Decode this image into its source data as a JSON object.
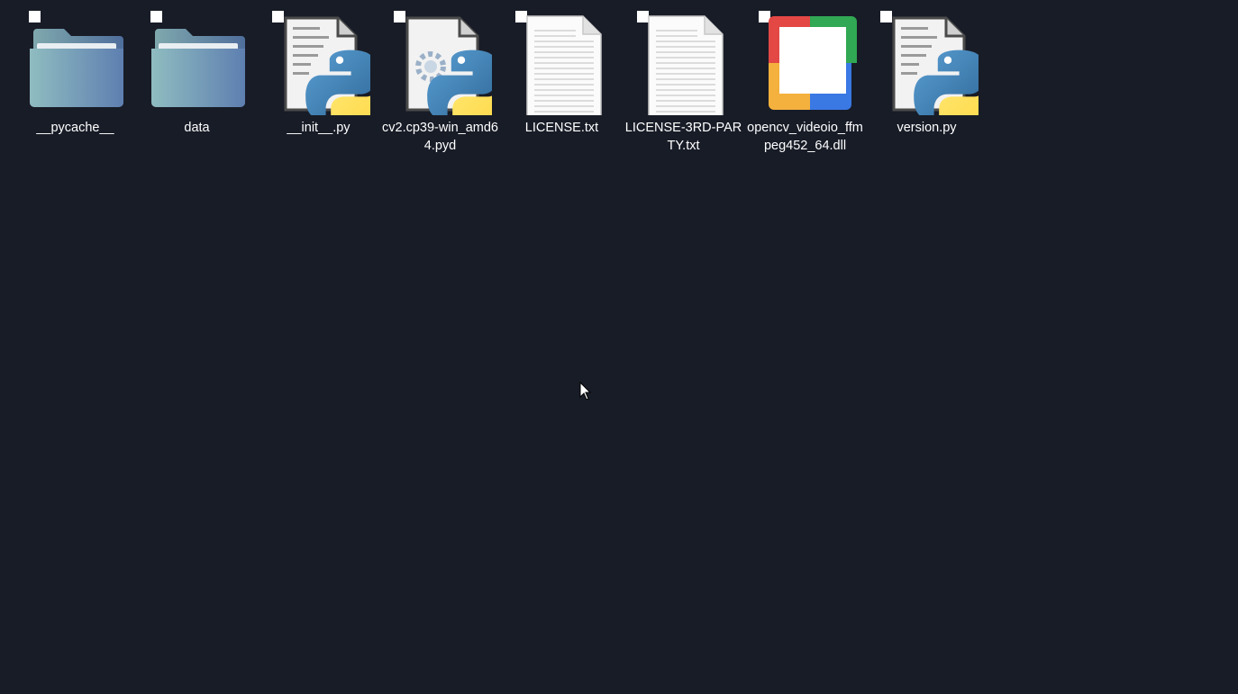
{
  "desktop": {
    "items": [
      {
        "label": "__pycache__",
        "icon": "folder-icon"
      },
      {
        "label": "data",
        "icon": "folder-icon"
      },
      {
        "label": "__init__.py",
        "icon": "python-file-icon"
      },
      {
        "label": "cv2.cp39-win_amd64.pyd",
        "icon": "python-extension-icon"
      },
      {
        "label": "LICENSE.txt",
        "icon": "text-file-icon"
      },
      {
        "label": "LICENSE-3RD-PARTY.txt",
        "icon": "text-file-icon"
      },
      {
        "label": "opencv_videoio_ffmpeg452_64.dll",
        "icon": "dll-file-icon"
      },
      {
        "label": "version.py",
        "icon": "python-file-icon"
      }
    ]
  },
  "colors": {
    "background": "#181c27",
    "label": "#ffffff"
  }
}
